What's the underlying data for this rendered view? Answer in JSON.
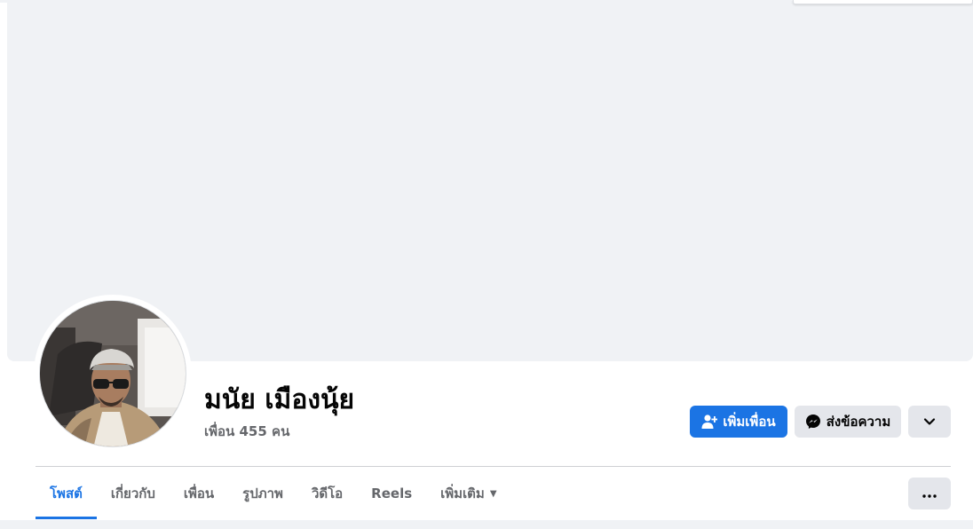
{
  "profile": {
    "name": "มนัย เมืองนุ้ย",
    "friends_text": "เพื่อน 455 คน"
  },
  "actions": {
    "add_friend_label": "เพิ่มเพื่อน",
    "add_friend_icon": "person-add-icon",
    "message_label": "ส่งข้อความ",
    "message_icon": "messenger-icon",
    "dropdown_icon": "chevron-down-icon"
  },
  "tabs": [
    {
      "label": "โพสต์",
      "active": true
    },
    {
      "label": "เกี่ยวกับ"
    },
    {
      "label": "เพื่อน"
    },
    {
      "label": "รูปภาพ"
    },
    {
      "label": "วิดีโอ"
    },
    {
      "label": "Reels"
    },
    {
      "label": "เพิ่มเติม",
      "has_caret": true
    }
  ],
  "tabs_overflow_icon": "ellipsis-icon",
  "colors": {
    "accent": "#1b74e4",
    "secondary_button": "#e4e6eb",
    "cover": "#f0f2f5",
    "muted_text": "#65676b"
  }
}
